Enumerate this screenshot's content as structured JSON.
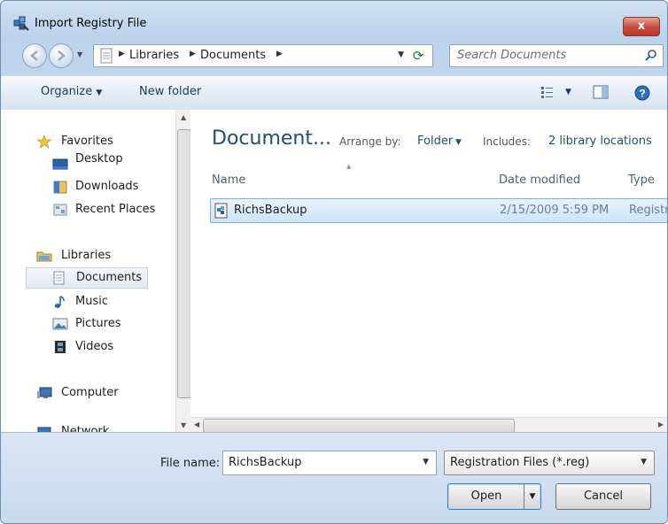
{
  "window": {
    "title": "Import Registry File",
    "close_label": "x"
  },
  "address": {
    "crumbs": [
      "Libraries",
      "Documents"
    ]
  },
  "search": {
    "placeholder": "Search Documents"
  },
  "toolbar": {
    "organize": "Organize",
    "new_folder": "New folder"
  },
  "nav": {
    "favorites": "Favorites",
    "desktop": "Desktop",
    "downloads": "Downloads",
    "recent_places": "Recent Places",
    "libraries": "Libraries",
    "documents": "Documents",
    "music": "Music",
    "pictures": "Pictures",
    "videos": "Videos",
    "computer": "Computer",
    "network": "Network"
  },
  "library": {
    "title": "Document...",
    "arrange_by_label": "Arrange by:",
    "arrange_by_value": "Folder",
    "includes_label": "Includes:",
    "includes_value": "2 library locations"
  },
  "columns": {
    "name": "Name",
    "date_modified": "Date modified",
    "type": "Type"
  },
  "files": [
    {
      "name": "RichsBackup",
      "date": "2/15/2009 5:59 PM",
      "type": "Registration Entries"
    }
  ],
  "bottom": {
    "file_name_label": "File name:",
    "file_name_value": "RichsBackup",
    "filter": "Registration Files (*.reg)",
    "open": "Open",
    "cancel": "Cancel"
  },
  "colors": {
    "title_blue": "#1e4e79",
    "selection": "#cfe3f8",
    "close_red": "#c8473a"
  }
}
